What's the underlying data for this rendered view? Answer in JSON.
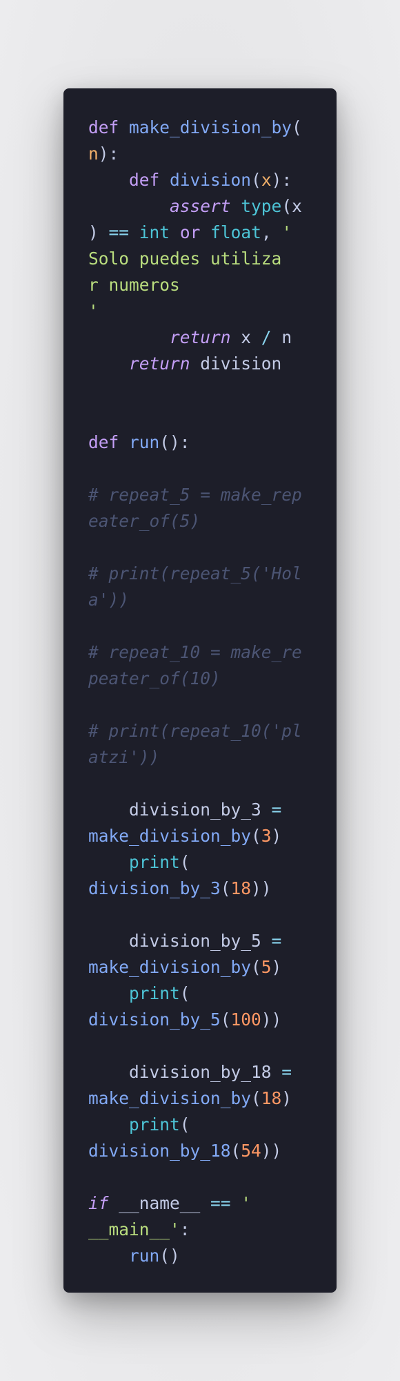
{
  "code": {
    "language": "python",
    "lines": [
      [
        [
          "kw",
          "def"
        ],
        [
          "tx",
          " "
        ],
        [
          "fn",
          "make_division_by"
        ],
        [
          "tx",
          "("
        ]
      ],
      [
        [
          "pa",
          "n"
        ],
        [
          "tx",
          "):"
        ]
      ],
      [
        [
          "tx",
          "    "
        ],
        [
          "kw",
          "def"
        ],
        [
          "tx",
          " "
        ],
        [
          "fn",
          "division"
        ],
        [
          "tx",
          "("
        ],
        [
          "pa",
          "x"
        ],
        [
          "tx",
          "):"
        ]
      ],
      [
        [
          "tx",
          "        "
        ],
        [
          "it",
          "assert"
        ],
        [
          "tx",
          " "
        ],
        [
          "bi",
          "type"
        ],
        [
          "tx",
          "("
        ],
        [
          "tx",
          "x"
        ]
      ],
      [
        [
          "tx",
          ") "
        ],
        [
          "op",
          "=="
        ],
        [
          "tx",
          " "
        ],
        [
          "bi",
          "int"
        ],
        [
          "tx",
          " "
        ],
        [
          "kw",
          "or"
        ],
        [
          "tx",
          " "
        ],
        [
          "bi",
          "float"
        ],
        [
          "tx",
          ", "
        ],
        [
          "st",
          "'"
        ]
      ],
      [
        [
          "st",
          "Solo puedes utiliza"
        ]
      ],
      [
        [
          "st",
          "r numeros"
        ]
      ],
      [
        [
          "st",
          "'"
        ]
      ],
      [
        [
          "tx",
          "        "
        ],
        [
          "it",
          "return"
        ],
        [
          "tx",
          " x "
        ],
        [
          "op",
          "/"
        ],
        [
          "tx",
          " n"
        ]
      ],
      [
        [
          "tx",
          "    "
        ],
        [
          "it",
          "return"
        ],
        [
          "tx",
          " division"
        ]
      ],
      [],
      [],
      [
        [
          "kw",
          "def"
        ],
        [
          "tx",
          " "
        ],
        [
          "fn",
          "run"
        ],
        [
          "tx",
          "():"
        ]
      ],
      [],
      [
        [
          "cm",
          "# repeat_5 = make_rep"
        ]
      ],
      [
        [
          "cm",
          "eater_of(5)"
        ]
      ],
      [],
      [
        [
          "cm",
          "# print(repeat_5('Hol"
        ]
      ],
      [
        [
          "cm",
          "a'))"
        ]
      ],
      [],
      [
        [
          "cm",
          "# repeat_10 = make_re"
        ]
      ],
      [
        [
          "cm",
          "peater_of(10)"
        ]
      ],
      [],
      [
        [
          "cm",
          "# print(repeat_10('pl"
        ]
      ],
      [
        [
          "cm",
          "atzi'))"
        ]
      ],
      [],
      [
        [
          "tx",
          "    division_by_3 "
        ],
        [
          "op",
          "="
        ]
      ],
      [
        [
          "fn",
          "make_division_by"
        ],
        [
          "tx",
          "("
        ],
        [
          "nu",
          "3"
        ],
        [
          "tx",
          ")"
        ]
      ],
      [
        [
          "tx",
          "    "
        ],
        [
          "bi",
          "print"
        ],
        [
          "tx",
          "("
        ]
      ],
      [
        [
          "fn",
          "division_by_3"
        ],
        [
          "tx",
          "("
        ],
        [
          "nu",
          "18"
        ],
        [
          "tx",
          "))"
        ]
      ],
      [],
      [
        [
          "tx",
          "    division_by_5 "
        ],
        [
          "op",
          "="
        ]
      ],
      [
        [
          "fn",
          "make_division_by"
        ],
        [
          "tx",
          "("
        ],
        [
          "nu",
          "5"
        ],
        [
          "tx",
          ")"
        ]
      ],
      [
        [
          "tx",
          "    "
        ],
        [
          "bi",
          "print"
        ],
        [
          "tx",
          "("
        ]
      ],
      [
        [
          "fn",
          "division_by_5"
        ],
        [
          "tx",
          "("
        ],
        [
          "nu",
          "100"
        ],
        [
          "tx",
          "))"
        ]
      ],
      [],
      [
        [
          "tx",
          "    division_by_18 "
        ],
        [
          "op",
          "="
        ]
      ],
      [
        [
          "fn",
          "make_division_by"
        ],
        [
          "tx",
          "("
        ],
        [
          "nu",
          "18"
        ],
        [
          "tx",
          ")"
        ]
      ],
      [
        [
          "tx",
          "    "
        ],
        [
          "bi",
          "print"
        ],
        [
          "tx",
          "("
        ]
      ],
      [
        [
          "fn",
          "division_by_18"
        ],
        [
          "tx",
          "("
        ],
        [
          "nu",
          "54"
        ],
        [
          "tx",
          "))"
        ]
      ],
      [],
      [
        [
          "it",
          "if"
        ],
        [
          "tx",
          " __name__ "
        ],
        [
          "op",
          "=="
        ],
        [
          "tx",
          " "
        ],
        [
          "st",
          "'"
        ]
      ],
      [
        [
          "st",
          "__main__'"
        ],
        [
          "tx",
          ":"
        ]
      ],
      [
        [
          "tx",
          "    "
        ],
        [
          "fn",
          "run"
        ],
        [
          "tx",
          "()"
        ]
      ]
    ]
  },
  "colors": {
    "background": "#ececee",
    "card": "#1d1e29",
    "keyword": "#c39ef5",
    "function": "#82a9f5",
    "builtin": "#4dc4d6",
    "parameter": "#f2b06a",
    "number": "#ff9864",
    "string": "#b9dd7e",
    "operator": "#8ad5ef",
    "comment": "#4c5574",
    "text": "#c3cbe6"
  }
}
